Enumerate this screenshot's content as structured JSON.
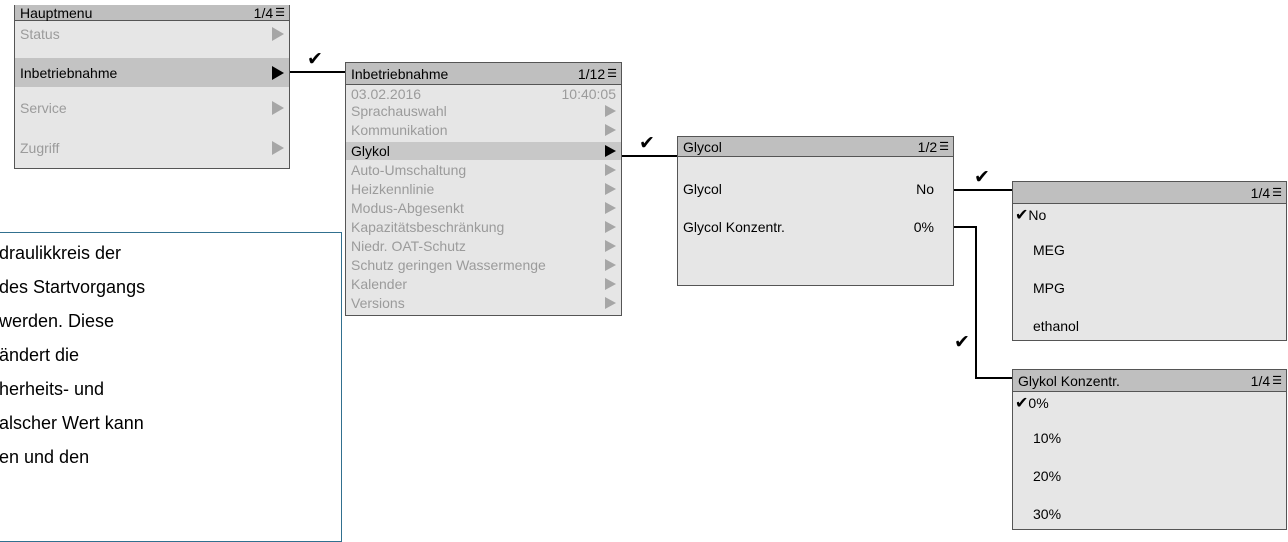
{
  "main_menu": {
    "title": "Hauptmenu",
    "page": "1/4",
    "items": [
      "Status",
      "Inbetriebnahme",
      "Service",
      "Zugriff"
    ]
  },
  "commissioning_menu": {
    "title": "Inbetriebnahme",
    "page": "1/12",
    "date": "03.02.2016",
    "time": "10:40:05",
    "items": [
      "Sprachauswahl",
      "Kommunikation",
      "Glykol",
      "Auto-Umschaltung",
      "Heizkennlinie",
      "Modus-Abgesenkt",
      "Kapazitätsbeschränkung",
      "Niedr. OAT-Schutz",
      "Schutz geringen Wassermenge",
      "Kalender",
      "Versions"
    ]
  },
  "glycol_menu": {
    "title": "Glycol",
    "page": "1/2",
    "rows": [
      {
        "label": "Glycol",
        "value": "No"
      },
      {
        "label": "Glycol Konzentr.",
        "value": "0%"
      }
    ]
  },
  "glycol_type_list": {
    "title": "",
    "page": "1/4",
    "options": [
      "No",
      "MEG",
      "MPG",
      "ethanol"
    ]
  },
  "glycol_conc_list": {
    "title": "Glykol Konzentr.",
    "page": "1/4",
    "options": [
      "0%",
      "10%",
      "20%",
      "30%"
    ]
  },
  "check_mark": "✔",
  "menu_icon_glyph": "☰",
  "note": {
    "lines": [
      "draulikkreis der",
      " des Startvorgangs",
      "werden. Diese",
      "ändert die",
      "herheits- und",
      "alscher Wert kann",
      "en und den"
    ]
  }
}
